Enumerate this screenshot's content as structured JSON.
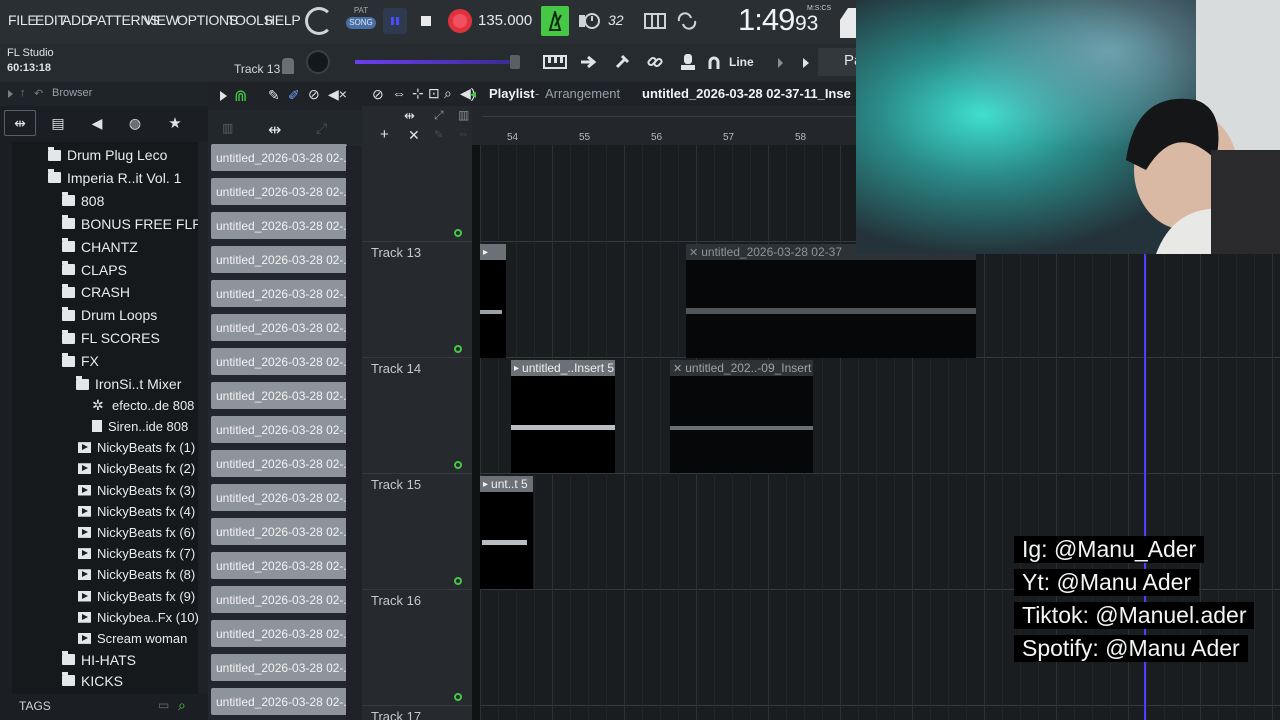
{
  "menu": [
    "FILE",
    "EDIT",
    "ADD",
    "PATTERNS",
    "VIEW",
    "OPTIONS",
    "TOOLS",
    "HELP"
  ],
  "transport": {
    "pat_label": "PAT",
    "song_label": "SONG",
    "tempo": "135.000",
    "time_main": "1:49",
    "time_sub": "93",
    "time_format": "M:S:CS",
    "cpu_readout": "32"
  },
  "hint": {
    "app_name": "FL Studio",
    "elapsed": "60:13:18",
    "track_name": "Track 13",
    "snap": "Line",
    "pattern_short": "Pa"
  },
  "browser": {
    "title": "Browser",
    "tags_label": "TAGS",
    "items": [
      {
        "label": "Drum Plug Leco",
        "type": "folder"
      },
      {
        "label": "Imperia R..it Vol. 1",
        "type": "folder"
      },
      {
        "label": "808",
        "type": "folder"
      },
      {
        "label": "BONUS FREE FLP",
        "type": "folder"
      },
      {
        "label": "CHANTZ",
        "type": "folder"
      },
      {
        "label": "CLAPS",
        "type": "folder"
      },
      {
        "label": "CRASH",
        "type": "folder"
      },
      {
        "label": "Drum Loops",
        "type": "folder"
      },
      {
        "label": "FL SCORES",
        "type": "folder"
      },
      {
        "label": "FX",
        "type": "folder"
      },
      {
        "label": "IronSi..t Mixer",
        "type": "folder"
      },
      {
        "label": "efecto..de 808",
        "type": "plugin"
      },
      {
        "label": "Siren..ide 808",
        "type": "file"
      },
      {
        "label": "NickyBeats fx (1)",
        "type": "audio"
      },
      {
        "label": "NickyBeats fx (2)",
        "type": "audio"
      },
      {
        "label": "NickyBeats fx (3)",
        "type": "audio"
      },
      {
        "label": "NickyBeats fx (4)",
        "type": "audio"
      },
      {
        "label": "NickyBeats fx (6)",
        "type": "audio"
      },
      {
        "label": "NickyBeats fx (7)",
        "type": "audio"
      },
      {
        "label": "NickyBeats fx (8)",
        "type": "audio"
      },
      {
        "label": "NickyBeats fx (9)",
        "type": "audio"
      },
      {
        "label": "Nickybea..Fx (10)",
        "type": "audio"
      },
      {
        "label": "Scream woman",
        "type": "audio"
      },
      {
        "label": "HI-HATS",
        "type": "folder"
      },
      {
        "label": "KICKS",
        "type": "folder"
      }
    ]
  },
  "patterns": [
    "untitled_2026-03-28 02-...",
    "untitled_2026-03-28 02-...",
    "untitled_2026-03-28 02-...",
    "untitled_2026-03-28 02-...",
    "untitled_2026-03-28 02-...",
    "untitled_2026-03-28 02-...",
    "untitled_2026-03-28 02-...",
    "untitled_2026-03-28 02-...",
    "untitled_2026-03-28 02-...",
    "untitled_2026-03-28 02-...",
    "untitled_2026-03-28 02-...",
    "untitled_2026-03-28 02-...",
    "untitled_2026-03-28 02-...",
    "untitled_2026-03-28 02-...",
    "untitled_2026-03-28 02-...",
    "untitled_2026-03-28 02-...",
    "untitled_2026-03-28 02-..."
  ],
  "playlist": {
    "title": "Playlist",
    "separator": "-",
    "subtitle": "Arrangement",
    "project": "untitled_2026-03-28 02-37-11_Inse",
    "ruler": [
      "54",
      "55",
      "56",
      "57",
      "58"
    ],
    "tracks": [
      "Track 13",
      "Track 14",
      "Track 15",
      "Track 16",
      "Track 17"
    ],
    "clips": {
      "t13_a": "",
      "t13_b": "untitled_2026-03-28 02-37",
      "t14_a": "untitled_..Insert 5",
      "t14_b": "untitled_202..-09_Insert 5",
      "t15_a": "unt..t 5"
    }
  },
  "overlay": {
    "ig": "Ig: @Manu_Ader",
    "yt": "Yt: @Manu Ader",
    "tiktok": "Tiktok: @Manuel.ader",
    "spotify": "Spotify: @Manu Ader"
  },
  "colors": {
    "accent_green": "#46c846",
    "record": "#e0323c",
    "purple_line": "#4b3cff"
  }
}
